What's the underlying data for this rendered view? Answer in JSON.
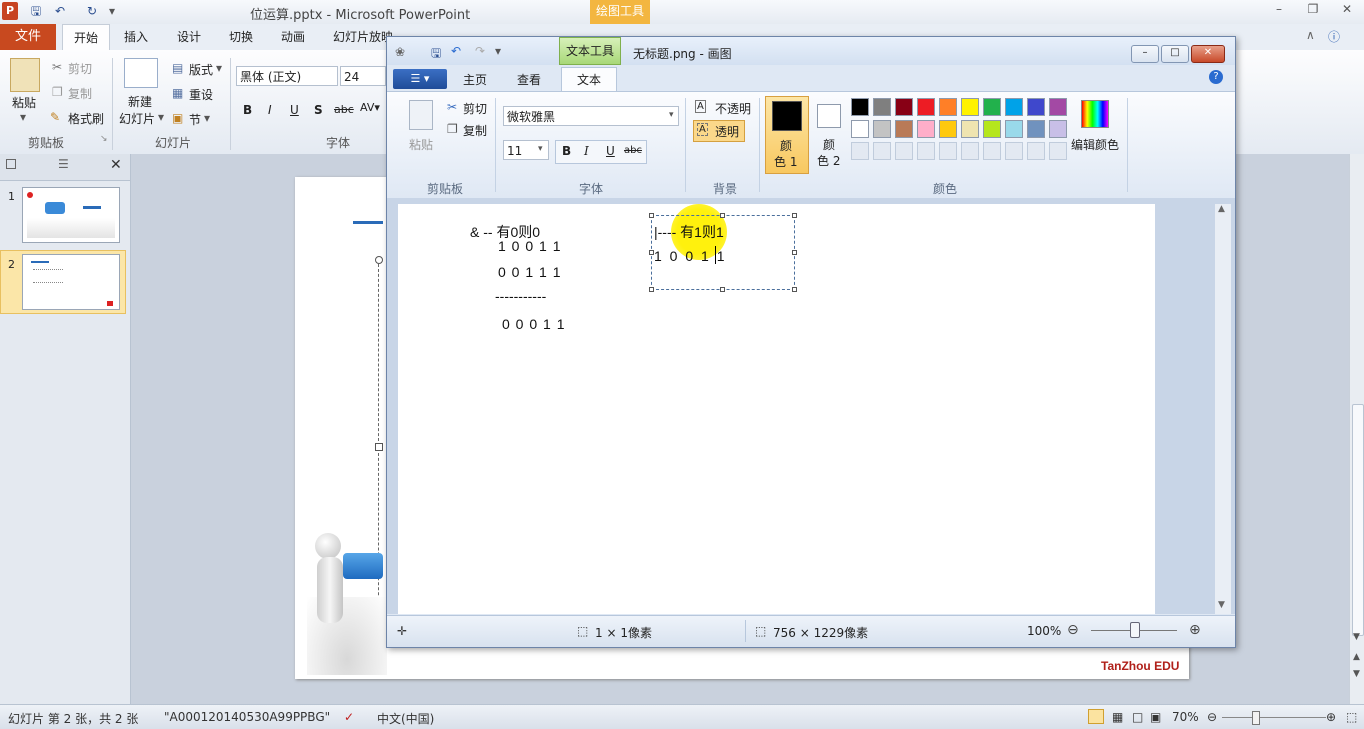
{
  "powerpoint": {
    "title": "位运算.pptx - Microsoft PowerPoint",
    "drawing_tools": "绘图工具",
    "tabs": [
      "文件",
      "开始",
      "插入",
      "设计",
      "切换",
      "动画",
      "幻灯片放映"
    ],
    "clipboard": {
      "paste": "粘贴",
      "cut": "剪切",
      "copy": "复制",
      "format_painter": "格式刷",
      "group": "剪贴板"
    },
    "slides": {
      "new_slide_line1": "新建",
      "new_slide_line2": "幻灯片",
      "layout": "版式",
      "reset": "重设",
      "section": "节",
      "group": "幻灯片"
    },
    "font": {
      "name": "黑体 (正文)",
      "size": "24",
      "group": "字体"
    },
    "slide_numbers": [
      "1",
      "2"
    ],
    "watermark": "TanZhou EDU",
    "status": {
      "slide_info": "幻灯片 第 2 张，共 2 张",
      "theme": "\"A000120140530A99PPBG\"",
      "language": "中文(中国)",
      "zoom": "70%"
    }
  },
  "paint": {
    "title": "无标题.png - 画图",
    "text_tools": "文本工具",
    "tabs": {
      "home": "主页",
      "view": "查看",
      "text": "文本"
    },
    "clipboard": {
      "paste": "粘贴",
      "cut": "剪切",
      "copy": "复制",
      "group": "剪贴板"
    },
    "font": {
      "name": "微软雅黑",
      "size": "11",
      "group": "字体",
      "bold": "B",
      "italic": "I",
      "underline": "U",
      "strike": "abc"
    },
    "background": {
      "opaque": "不透明",
      "transparent": "透明",
      "group": "背景"
    },
    "colors": {
      "color1_a": "颜",
      "color1_b": "色 1",
      "color2_a": "颜",
      "color2_b": "色 2",
      "edit": "编辑颜色",
      "group": "颜色",
      "color1": "#000000",
      "color2": "#ffffff",
      "palette_row1": [
        "#000000",
        "#7f7f7f",
        "#880015",
        "#ed1c24",
        "#ff7f27",
        "#fff200",
        "#22b14c",
        "#00a2e8",
        "#3f48cc",
        "#a349a4"
      ],
      "palette_row2": [
        "#ffffff",
        "#c3c3c3",
        "#b97a57",
        "#ffaec9",
        "#ffc90e",
        "#efe4b0",
        "#b5e61d",
        "#99d9ea",
        "#7092be",
        "#c8bfe7"
      ]
    },
    "canvas_text": {
      "and_title": "& -- 有0则0",
      "and_row1": "1 0 0 1 1",
      "and_row2": "0 0 1 1 1",
      "and_line": "-----------",
      "and_result": "0  0 0 1 1",
      "or_title": "|---- 有1则1",
      "or_row1": "1 0 0 1 1"
    },
    "status": {
      "selection": "1 × 1像素",
      "size": "756 × 1229像素",
      "zoom": "100%"
    }
  }
}
